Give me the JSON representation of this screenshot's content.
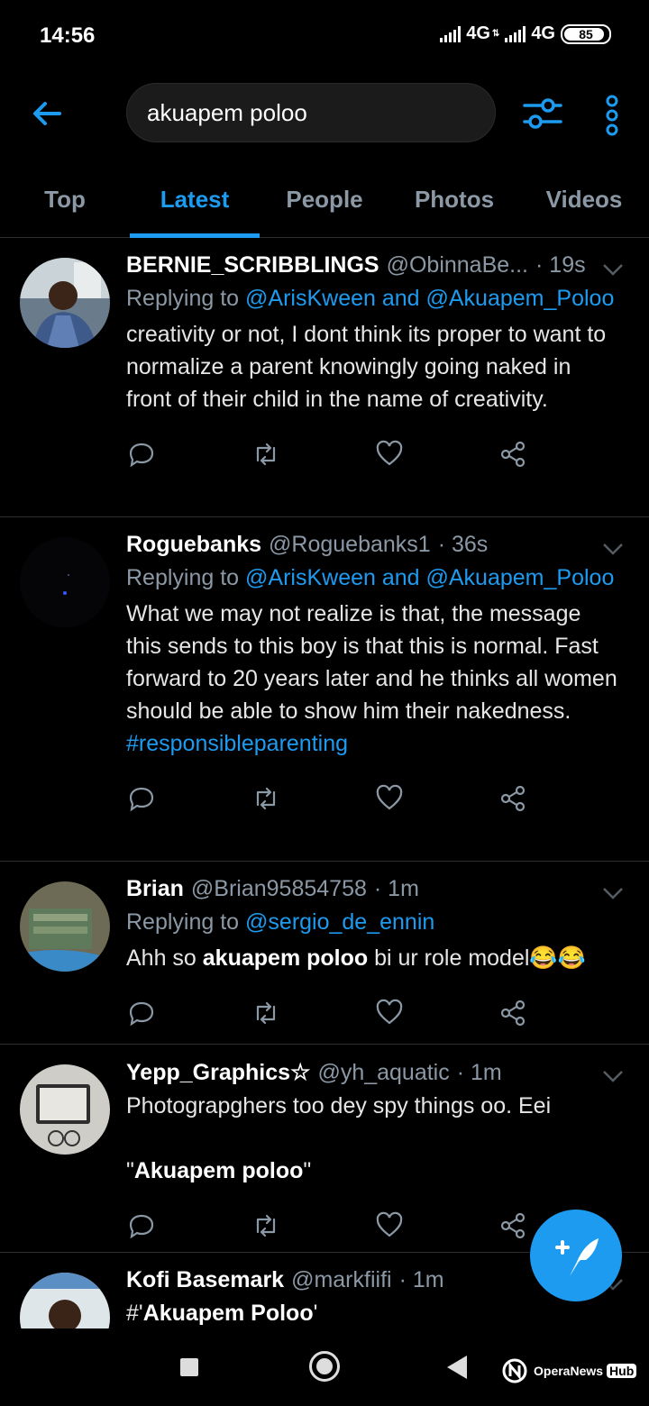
{
  "status_bar": {
    "time": "14:56",
    "network1": "4G",
    "network2": "4G",
    "battery": "85"
  },
  "search": {
    "query": "akuapem poloo"
  },
  "tabs": [
    {
      "label": "Top",
      "active": false
    },
    {
      "label": "Latest",
      "active": true
    },
    {
      "label": "People",
      "active": false
    },
    {
      "label": "Photos",
      "active": false
    },
    {
      "label": "Videos",
      "active": false
    }
  ],
  "tweets": [
    {
      "name": "BERNIE_SCRIBBLINGS",
      "handle": "@ObinnaBe...",
      "time": "· 19s",
      "reply_prefix": "Replying to ",
      "reply_to": "@ArisKween and @Akuapem_Poloo",
      "text": "creativity or not, I dont think its proper to want to normalize a parent knowingly going naked in front of their child in the name of creativity."
    },
    {
      "name": "Roguebanks",
      "handle": "@Roguebanks1",
      "time": "· 36s",
      "reply_prefix": "Replying to ",
      "reply_to": "@ArisKween and @Akuapem_Poloo",
      "text": "What we may not realize is that, the message this sends to this boy is that this is normal. Fast forward to 20 years later and he thinks all women should be able to show him their nakedness.",
      "hashtag": "#responsibleparenting"
    },
    {
      "name": "Brian",
      "handle": "@Brian95854758",
      "time": "· 1m",
      "reply_prefix": "Replying to ",
      "reply_to": "@sergio_de_ennin",
      "text_before": "Ahh so ",
      "text_bold": "akuapem poloo",
      "text_after": " bi ur role model😂😂"
    },
    {
      "name": "Yepp_Graphics☆",
      "handle": "@yh_aquatic",
      "time": "· 1m",
      "text_line1": "Photograpghers too dey spy things oo. Eei",
      "text_line2_before": "\"",
      "text_line2_bold": "Akuapem poloo",
      "text_line2_after": "\""
    },
    {
      "name": "Kofi Basemark",
      "handle": "@markfiifi",
      "time": "· 1m",
      "text_before": "#'",
      "text_bold": "Akuapem Poloo",
      "text_after": "'"
    }
  ],
  "watermark": {
    "brand": "OperaNews",
    "suffix": "Hub"
  },
  "colors": {
    "accent": "#1d9bf0",
    "background": "#000000",
    "muted": "#8b98a5"
  }
}
